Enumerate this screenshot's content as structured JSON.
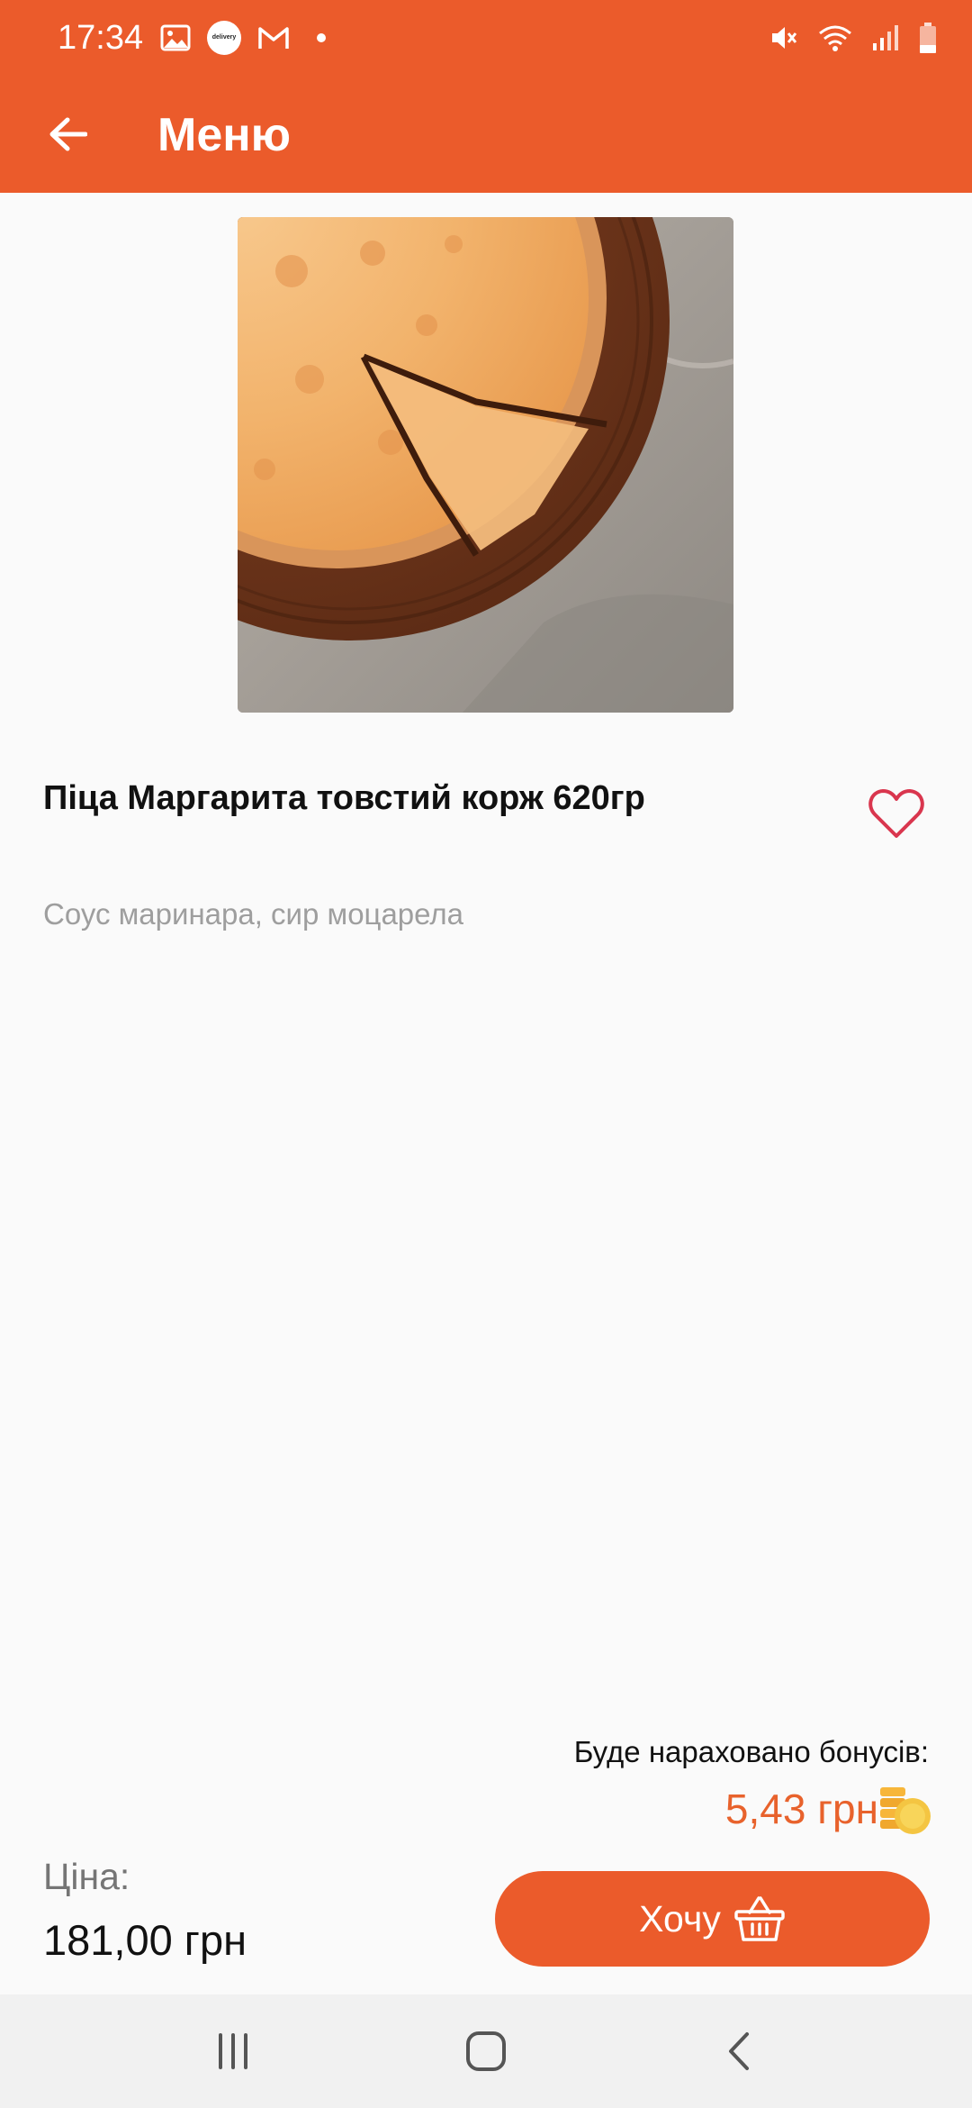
{
  "status_bar": {
    "time": "17:34",
    "app_icon_text": "delivery",
    "left_icons": [
      "image-icon",
      "delivery-app-icon",
      "gmail-icon",
      "notification-dot-icon"
    ],
    "right_icons": [
      "mute-icon",
      "wifi-icon",
      "signal-icon",
      "battery-icon"
    ]
  },
  "app_bar": {
    "title": "Меню",
    "back_icon": "arrow-left-icon"
  },
  "product": {
    "name": "Піца Маргарита товстий корж 620гр",
    "description": "Соус маринара, сир моцарела",
    "favorite_icon": "heart-icon"
  },
  "bonus": {
    "label": "Буде нараховано бонусів:",
    "value": "5,43 грн",
    "icon": "coins-icon"
  },
  "price": {
    "label": "Ціна:",
    "value": "181,00 грн"
  },
  "order_button": {
    "label": "Хочу",
    "icon": "basket-icon"
  },
  "nav_bar": {
    "items": [
      "recent-apps-icon",
      "home-icon",
      "back-icon"
    ]
  },
  "colors": {
    "accent": "#eb5b2b",
    "bonus_text": "#e8622c",
    "heart": "#d9364e",
    "background": "#fafafa"
  }
}
